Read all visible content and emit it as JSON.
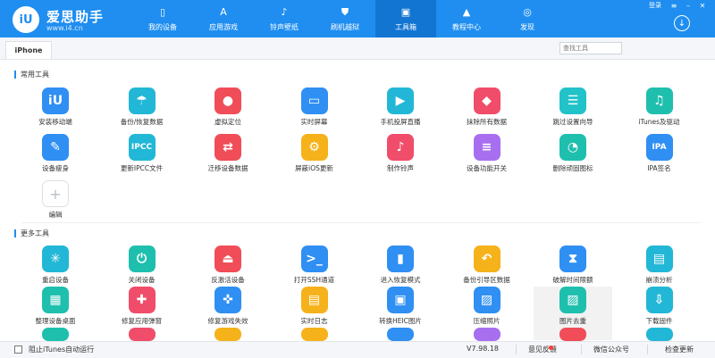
{
  "app": {
    "brand_name": "爱思助手",
    "brand_url": "www.i4.cn",
    "logo_text": "iU"
  },
  "nav": [
    {
      "label": "我的设备",
      "icon": "phone-icon"
    },
    {
      "label": "应用游戏",
      "icon": "apps-icon"
    },
    {
      "label": "铃声壁纸",
      "icon": "music-icon"
    },
    {
      "label": "刷机越狱",
      "icon": "shield-icon"
    },
    {
      "label": "工具箱",
      "icon": "toolbox-icon",
      "active": true
    },
    {
      "label": "教程中心",
      "icon": "graduation-cap-icon"
    },
    {
      "label": "发现",
      "icon": "compass-icon"
    }
  ],
  "window": {
    "login": "登录"
  },
  "tab": {
    "label": "iPhone"
  },
  "search": {
    "placeholder": "查找工具"
  },
  "sections": {
    "common_title": "常用工具",
    "more_title": "更多工具"
  },
  "common_tools": [
    {
      "label": "安装移动端",
      "icon": "install-icon",
      "color": "#2f8ff3",
      "glyph": "iU"
    },
    {
      "label": "备份/恢复数据",
      "icon": "umbrella-icon",
      "color": "#22b7d6",
      "glyph": "☂"
    },
    {
      "label": "虚拟定位",
      "icon": "location-icon",
      "color": "#f04d58",
      "glyph": "●"
    },
    {
      "label": "实时屏幕",
      "icon": "screen-icon",
      "color": "#2f8ff3",
      "glyph": "▭"
    },
    {
      "label": "手机投屏直播",
      "icon": "cast-icon",
      "color": "#22b7d6",
      "glyph": "▶"
    },
    {
      "label": "抹除所有数据",
      "icon": "eraser-icon",
      "color": "#f04d6a",
      "glyph": "◆"
    },
    {
      "label": "跳过设置向导",
      "icon": "guide-icon",
      "color": "#22c2c9",
      "glyph": "☰"
    },
    {
      "label": "iTunes及驱动",
      "icon": "itunes-icon",
      "color": "#1fbfae",
      "glyph": "♫"
    },
    {
      "label": "设备瘦身",
      "icon": "broom-icon",
      "color": "#2f8ff3",
      "glyph": "✎"
    },
    {
      "label": "更新IPCC文件",
      "icon": "ipcc-icon",
      "color": "#22b7d6",
      "glyph": "IPCC"
    },
    {
      "label": "迁移设备数据",
      "icon": "migrate-icon",
      "color": "#f04d58",
      "glyph": "⇄"
    },
    {
      "label": "屏蔽iOS更新",
      "icon": "gear-icon",
      "color": "#f6b21b",
      "glyph": "⚙"
    },
    {
      "label": "制作铃声",
      "icon": "ringtone-icon",
      "color": "#f04d6a",
      "glyph": "♪"
    },
    {
      "label": "设备功能开关",
      "icon": "toggle-icon",
      "color": "#a76ff0",
      "glyph": "≡"
    },
    {
      "label": "删除顽固图标",
      "icon": "pie-icon",
      "color": "#1fbfae",
      "glyph": "◔"
    },
    {
      "label": "IPA签名",
      "icon": "ipa-icon",
      "color": "#2f8ff3",
      "glyph": "IPA"
    },
    {
      "label": "编辑",
      "icon": "plus-icon",
      "color": "#ffffff",
      "glyph": "+"
    }
  ],
  "more_tools": [
    {
      "label": "重启设备",
      "icon": "restart-icon",
      "color": "#22b7d6",
      "glyph": "✳"
    },
    {
      "label": "关闭设备",
      "icon": "power-icon",
      "color": "#1fbfae",
      "glyph": "⏻"
    },
    {
      "label": "反激活设备",
      "icon": "deactivate-icon",
      "color": "#f04d58",
      "glyph": "⏏"
    },
    {
      "label": "打开SSH通道",
      "icon": "ssh-icon",
      "color": "#2f8ff3",
      "glyph": ">_"
    },
    {
      "label": "进入恢复模式",
      "icon": "recovery-icon",
      "color": "#2f8ff3",
      "glyph": "▮"
    },
    {
      "label": "备份引导区数据",
      "icon": "backup-boot-icon",
      "color": "#f6b21b",
      "glyph": "↶"
    },
    {
      "label": "破解时间限额",
      "icon": "hourglass-icon",
      "color": "#2f8ff3",
      "glyph": "⧗"
    },
    {
      "label": "崩溃分析",
      "icon": "crash-log-icon",
      "color": "#22b7d6",
      "glyph": "▤"
    },
    {
      "label": "整理设备桌面",
      "icon": "desktop-grid-icon",
      "color": "#1fbfae",
      "glyph": "▦"
    },
    {
      "label": "修复应用弹窗",
      "icon": "app-repair-icon",
      "color": "#f04d6a",
      "glyph": "✚"
    },
    {
      "label": "修复游戏失效",
      "icon": "gamepad-icon",
      "color": "#2f8ff3",
      "glyph": "✜"
    },
    {
      "label": "实时日志",
      "icon": "log-icon",
      "color": "#f6b21b",
      "glyph": "▤"
    },
    {
      "label": "转换HEIC图片",
      "icon": "heic-icon",
      "color": "#2f8ff3",
      "glyph": "▣"
    },
    {
      "label": "压缩照片",
      "icon": "compress-photo-icon",
      "color": "#2f8ff3",
      "glyph": "▨"
    },
    {
      "label": "图片去重",
      "icon": "dedupe-photo-icon",
      "color": "#1fbfae",
      "glyph": "▨",
      "highlight": true
    },
    {
      "label": "下载固件",
      "icon": "download-firmware-icon",
      "color": "#22b7d6",
      "glyph": "⇩"
    }
  ],
  "partial_row_colors": [
    "#1fbfae",
    "#f04d6a",
    "#f6b21b",
    "#f6b21b",
    "#2f8ff3",
    "#a76ff0",
    "#f04d58",
    "#22b7d6"
  ],
  "status": {
    "checkbox_label": "阻止iTunes自动运行",
    "version": "V7.98.18",
    "feedback": "意见反馈",
    "wechat": "微信公众号",
    "update": "检查更新"
  }
}
